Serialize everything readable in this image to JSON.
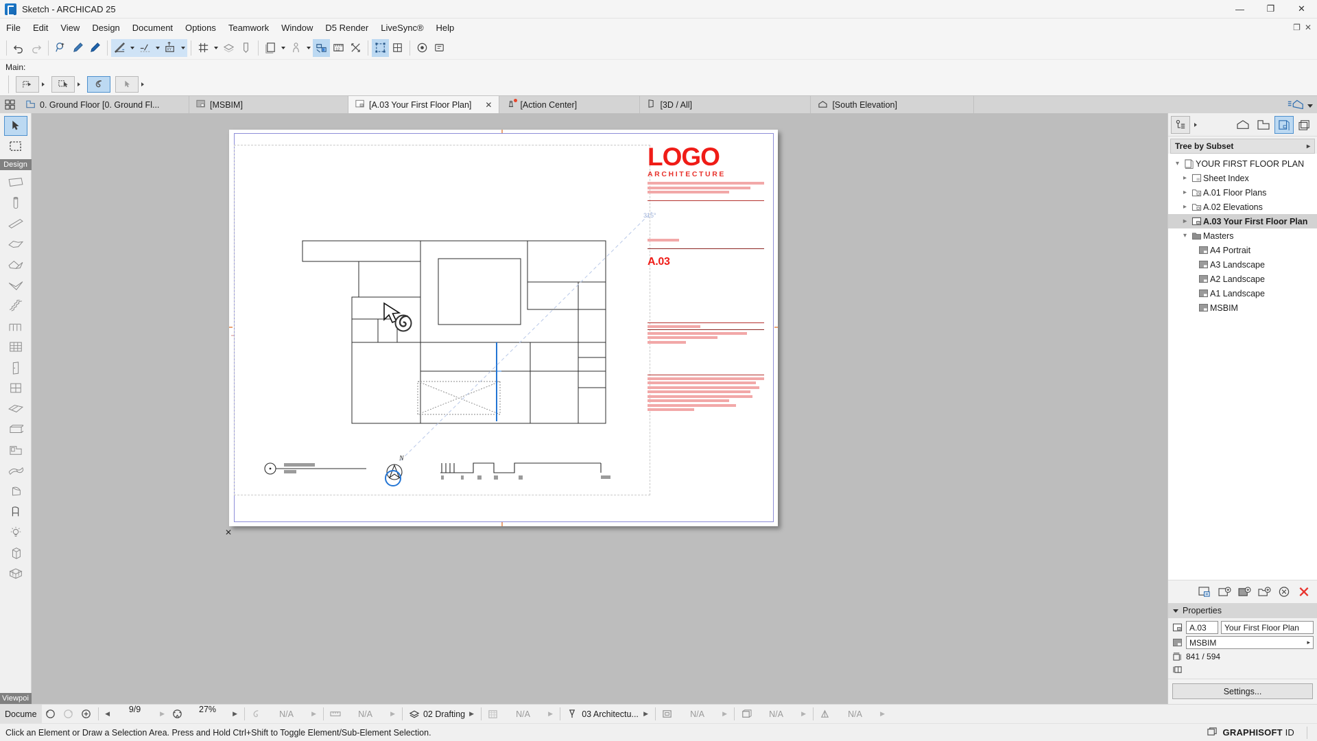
{
  "window": {
    "title": "Sketch - ARCHICAD 25",
    "app_icon": "archicad-logo-icon",
    "minimize": "—",
    "maximize": "❐",
    "close": "✕",
    "restore_small": "❐",
    "close_small": "✕"
  },
  "menubar": {
    "items": [
      {
        "label": "File"
      },
      {
        "label": "Edit"
      },
      {
        "label": "View"
      },
      {
        "label": "Design"
      },
      {
        "label": "Document"
      },
      {
        "label": "Options"
      },
      {
        "label": "Teamwork"
      },
      {
        "label": "Window"
      },
      {
        "label": "D5 Render"
      },
      {
        "label": "LiveSync®"
      },
      {
        "label": "Help"
      }
    ]
  },
  "toolbar": {
    "undo": "undo-icon",
    "redo": "redo-icon",
    "find": "find-select-icon",
    "eyedropper": "parameter-transfer-icon",
    "syringe": "parameter-inject-icon",
    "magic_wand": "magic-wand-icon",
    "snap_guide": "guide-line-icon",
    "coord_xy": "coordinate-box-icon",
    "grid_snap": "grid-snap-icon",
    "layers": "layers-icon",
    "pen": "pen-set-icon",
    "doc_set": "document-set-icon",
    "person": "person-scale-icon",
    "measure": "dimension-icon",
    "ruler": "ruler-icon",
    "marquee": "marquee-icon",
    "element_xform": "element-transform-icon",
    "extra": "extra-icon",
    "model_view": "model-view-icon",
    "renovation": "renovation-filter-icon"
  },
  "mainbar": {
    "label": "Main:",
    "buttons": [
      {
        "name": "drafting-tool",
        "selected": false,
        "has_arrow": true
      },
      {
        "name": "marquee-tool",
        "selected": false,
        "has_arrow": true
      },
      {
        "name": "magic-wand-tool",
        "selected": true,
        "has_arrow": false
      },
      {
        "name": "arrow-tool",
        "selected": false,
        "has_arrow": true
      }
    ]
  },
  "tabs": {
    "grid_button": "tab-grid-icon",
    "items": [
      {
        "label": "0. Ground Floor [0. Ground Fl...",
        "icon": "floorplan-icon",
        "active": false,
        "closable": false,
        "badge": false
      },
      {
        "label": "[MSBIM]",
        "icon": "layout-icon",
        "active": false,
        "closable": false,
        "badge": false
      },
      {
        "label": "[A.03 Your First Floor Plan]",
        "icon": "layout-icon",
        "active": true,
        "closable": true,
        "badge": false
      },
      {
        "label": "[Action Center]",
        "icon": "lighthouse-icon",
        "active": false,
        "closable": false,
        "badge": true
      },
      {
        "label": "[3D / All]",
        "icon": "3d-view-icon",
        "active": false,
        "closable": false,
        "badge": false
      },
      {
        "label": "[South Elevation]",
        "icon": "elevation-icon",
        "active": false,
        "closable": false,
        "badge": false
      }
    ],
    "tail_icon": "view-mode-icon"
  },
  "toolbox": {
    "top_tools": [
      {
        "name": "arrow-select-tool",
        "selected": true
      },
      {
        "name": "marquee-tool",
        "selected": false
      }
    ],
    "design_label": "Design",
    "design_tools": [
      {
        "name": "wall-tool"
      },
      {
        "name": "column-tool"
      },
      {
        "name": "beam-tool"
      },
      {
        "name": "slab-tool"
      },
      {
        "name": "roof-tool"
      },
      {
        "name": "shell-tool"
      },
      {
        "name": "stair-tool"
      },
      {
        "name": "railing-tool"
      },
      {
        "name": "curtain-wall-tool"
      },
      {
        "name": "door-tool"
      },
      {
        "name": "window-tool"
      },
      {
        "name": "skylight-tool"
      },
      {
        "name": "wall-end-tool"
      },
      {
        "name": "zone-tool"
      },
      {
        "name": "mesh-tool"
      },
      {
        "name": "morph-tool"
      },
      {
        "name": "object-tool"
      },
      {
        "name": "lamp-tool"
      },
      {
        "name": "stair-object-tool"
      },
      {
        "name": "curtain-grid-tool"
      }
    ],
    "bottom_label": "Viewpoi"
  },
  "navigator": {
    "top_buttons": [
      {
        "name": "navigator-options-button",
        "icon": "tree-options-icon",
        "boxed": true,
        "arrow": true
      },
      {
        "name": "project-map-button",
        "icon": "house-icon",
        "active": false
      },
      {
        "name": "view-map-button",
        "icon": "view-map-icon",
        "active": false
      },
      {
        "name": "layout-book-button",
        "icon": "layout-book-icon",
        "active": true
      },
      {
        "name": "publisher-sets-button",
        "icon": "publisher-icon",
        "active": false
      }
    ],
    "subset_label": "Tree by Subset",
    "tree": [
      {
        "label": "YOUR FIRST FLOOR PLAN",
        "indent": 0,
        "twisty": "down",
        "icon": "layout-book-icon",
        "selected": false,
        "bold": false
      },
      {
        "label": "Sheet Index",
        "indent": 1,
        "twisty": "right",
        "icon": "subset-icon",
        "selected": false,
        "bold": false
      },
      {
        "label": "A.01 Floor Plans",
        "indent": 1,
        "twisty": "right",
        "icon": "folder-subset-icon",
        "selected": false,
        "bold": false
      },
      {
        "label": "A.02 Elevations",
        "indent": 1,
        "twisty": "right",
        "icon": "folder-subset-icon",
        "selected": false,
        "bold": false
      },
      {
        "label": "A.03 Your First Floor Plan",
        "indent": 1,
        "twisty": "right",
        "icon": "layout-icon",
        "selected": true,
        "bold": true
      },
      {
        "label": "Masters",
        "indent": 1,
        "twisty": "down",
        "icon": "folder-icon",
        "selected": false,
        "bold": false
      },
      {
        "label": "A4 Portrait",
        "indent": 2,
        "twisty": "none",
        "icon": "master-layout-icon",
        "selected": false,
        "bold": false
      },
      {
        "label": "A3 Landscape",
        "indent": 2,
        "twisty": "none",
        "icon": "master-layout-icon",
        "selected": false,
        "bold": false
      },
      {
        "label": "A2 Landscape",
        "indent": 2,
        "twisty": "none",
        "icon": "master-layout-icon",
        "selected": false,
        "bold": false
      },
      {
        "label": "A1 Landscape",
        "indent": 2,
        "twisty": "none",
        "icon": "master-layout-icon",
        "selected": false,
        "bold": false
      },
      {
        "label": "MSBIM",
        "indent": 2,
        "twisty": "none",
        "icon": "master-layout-icon",
        "selected": false,
        "bold": false
      }
    ],
    "actions": [
      {
        "name": "new-layout-button",
        "icon": "layout-settings-icon"
      },
      {
        "name": "new-subset-button",
        "icon": "new-layout-icon"
      },
      {
        "name": "new-master-button",
        "icon": "new-master-icon"
      },
      {
        "name": "new-folder-button",
        "icon": "new-subset-icon"
      },
      {
        "name": "update-button",
        "icon": "refresh-icon"
      },
      {
        "name": "delete-button",
        "icon": "close-red-icon"
      }
    ],
    "properties": {
      "title": "Properties",
      "id_icon": "layout-icon",
      "id_value": "A.03",
      "name_value": "Your First Floor Plan",
      "master_icon": "master-layout-icon",
      "master_value": "MSBIM",
      "size_icon": "size-icon",
      "size_value": "841 / 594",
      "margin_icon": "margin-icon"
    },
    "settings_button": "Settings..."
  },
  "sheet": {
    "titleblock": {
      "logo": "LOGO",
      "subtitle": "ARCHITECTURE",
      "sheet_number": "A.03"
    },
    "annotations": {
      "angle_label": "315°",
      "north_label": "N"
    }
  },
  "statusbar": {
    "first_label": "Docume",
    "zoom_out_icon": "zoom-previous-icon",
    "zoom_next_icon": "zoom-next-icon",
    "zoom_fit_icon": "zoom-in-icon",
    "page_value": "9/9",
    "orbit_icon": "fit-in-window-icon",
    "zoom_value": "27%",
    "segments": [
      {
        "icon": "magic-wand-icon",
        "value": "N/A",
        "dim": true
      },
      {
        "icon": "dimension-icon",
        "value": "N/A",
        "dim": true
      },
      {
        "icon": "layers-icon",
        "value": "02 Drafting",
        "dim": false
      },
      {
        "icon": "pen-set-icon",
        "value": "N/A",
        "dim": true
      },
      {
        "icon": "model-view-icon",
        "value": "03 Architectu...",
        "dim": false
      },
      {
        "icon": "view-mode-icon",
        "value": "N/A",
        "dim": true
      },
      {
        "icon": "renovation-icon",
        "value": "N/A",
        "dim": true
      },
      {
        "icon": "graphic-override-icon",
        "value": "N/A",
        "dim": true
      }
    ],
    "settings_label": "Settings..."
  },
  "messagebar": {
    "text": "Click an Element or Draw a Selection Area. Press and Hold Ctrl+Shift to Toggle Element/Sub-Element Selection.",
    "graphisoft_bold": "GRAPHISOFT",
    "graphisoft_rest": " ID",
    "gs_icon": "graphisoft-window-icon"
  }
}
